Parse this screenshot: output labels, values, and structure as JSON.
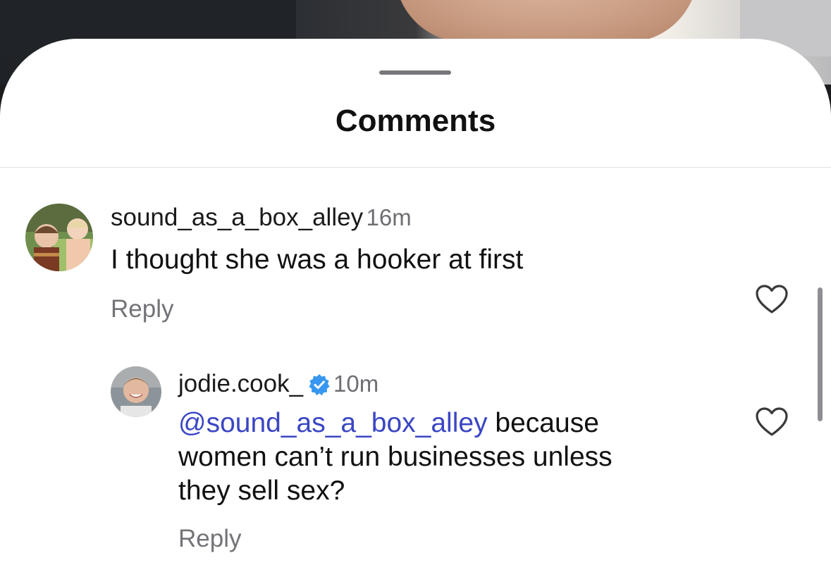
{
  "sheet": {
    "title": "Comments"
  },
  "comments": [
    {
      "username": "sound_as_a_box_alley",
      "time": "16m",
      "text": "I thought she was a hooker at first",
      "reply_label": "Reply"
    }
  ],
  "replies": [
    {
      "username": "jodie.cook_",
      "verified": true,
      "time": "10m",
      "mention": "@sound_as_a_box_alley",
      "text_line1": " because",
      "text_line2": "women can’t run businesses unless",
      "text_line3": "they sell sex?",
      "reply_label": "Reply"
    }
  ],
  "icons": {
    "like": "heart-outline-icon",
    "verified": "verified-badge-icon"
  },
  "colors": {
    "mention": "#3b46c4",
    "verified_badge": "#3897f0",
    "secondary_text": "#737378"
  }
}
